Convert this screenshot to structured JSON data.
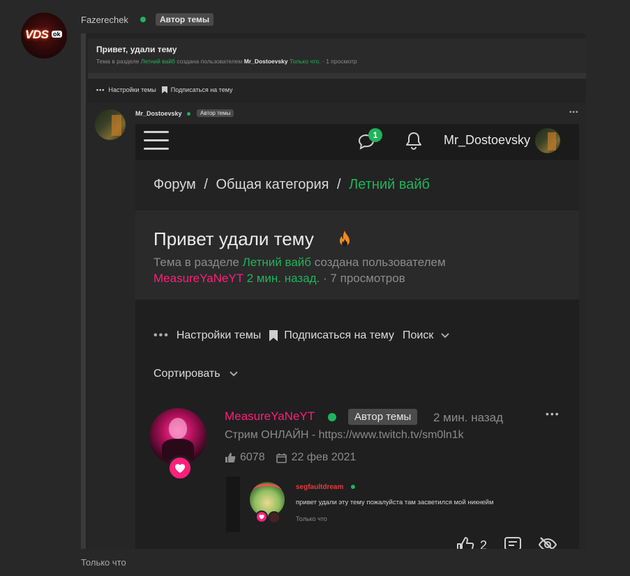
{
  "outer_post": {
    "username": "Fazerechek",
    "author_badge": "Автор темы",
    "avatar": {
      "text": "VDS",
      "sub": "ok"
    },
    "footer_time": "Только что"
  },
  "topic_header": {
    "title": "Привет, удали тему",
    "meta_prefix": "Тема в разделе",
    "section": "Летний вайб",
    "created_by": "создана пользователем",
    "author": "Mr_Dostoevsky",
    "time": "Только что.",
    "views": "· 1 просмотр"
  },
  "actions_small": {
    "settings": "Настройки темы",
    "subscribe": "Подписаться на тему"
  },
  "inner_post": {
    "username": "Mr_Dostoevsky",
    "author_badge": "Автор темы"
  },
  "screenshot": {
    "topbar": {
      "username": "Mr_Dostoevsky",
      "notif_count": "1"
    },
    "breadcrumb": {
      "forum": "Форум",
      "sep": "/",
      "category": "Общая категория",
      "section": "Летний вайб"
    },
    "title": "Привет удали тему",
    "meta_prefix": "Тема в разделе",
    "section": "Летний вайб",
    "created_by": "создана пользователем",
    "author": "MeasureYaNeYT",
    "time": "2 мин. назад.",
    "views": "· 7 просмотров",
    "actions": {
      "settings": "Настройки темы",
      "subscribe": "Подписаться на тему",
      "search": "Поиск",
      "sort": "Сортировать"
    },
    "post": {
      "username": "MeasureYaNeYT",
      "author_badge": "Автор темы",
      "time": "2 мин. назад",
      "status": "Стрим ОНЛАЙН - https://www.twitch.tv/sm0ln1k",
      "likes": "6078",
      "joined": "22 фев 2021",
      "reply": {
        "username": "segfaultdream",
        "text": "привет удали эту тему пожалуйста там засветился мой никнейм",
        "time": "Только что"
      },
      "like_count": "2"
    }
  },
  "colors": {
    "accent_green": "#21b35b",
    "accent_pink": "#ff1f7a",
    "bg": "#282828"
  }
}
